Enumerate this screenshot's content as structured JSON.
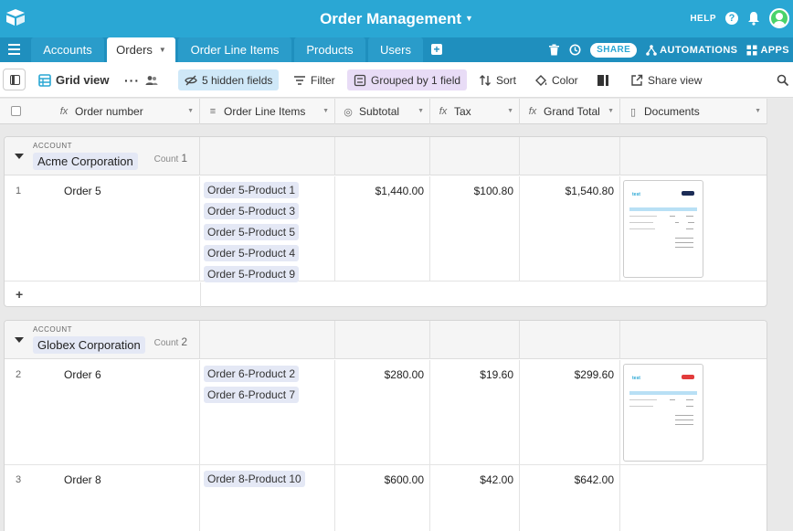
{
  "app": {
    "title": "Order Management",
    "help_label": "HELP",
    "brand_color": "#2aa7d4",
    "icons": [
      "base-logo-icon",
      "caret-down-icon",
      "help-icon",
      "bell-icon",
      "avatar"
    ]
  },
  "tabs": [
    {
      "label": "Accounts",
      "active": false
    },
    {
      "label": "Orders",
      "active": true
    },
    {
      "label": "Order Line Items",
      "active": false
    },
    {
      "label": "Products",
      "active": false
    },
    {
      "label": "Users",
      "active": false
    }
  ],
  "tabbar_actions": {
    "share": "SHARE",
    "automations": "AUTOMATIONS",
    "apps": "APPS"
  },
  "toolbar": {
    "view_name": "Grid view",
    "hidden_fields": "5 hidden fields",
    "filter": "Filter",
    "grouped": "Grouped by 1 field",
    "sort": "Sort",
    "color": "Color",
    "share_view": "Share view"
  },
  "columns": [
    {
      "name": "Order number",
      "icon": "formula-icon",
      "glyph": "fx"
    },
    {
      "name": "Order Line Items",
      "icon": "linked-records-icon",
      "glyph": "≡"
    },
    {
      "name": "Subtotal",
      "icon": "rollup-icon",
      "glyph": "◎"
    },
    {
      "name": "Tax",
      "icon": "formula-icon",
      "glyph": "fx"
    },
    {
      "name": "Grand Total",
      "icon": "formula-icon",
      "glyph": "fx"
    },
    {
      "name": "Documents",
      "icon": "attachment-icon",
      "glyph": "▯"
    }
  ],
  "groups": [
    {
      "field": "ACCOUNT",
      "name": "Acme Corporation",
      "count_label": "Count",
      "count": "1"
    },
    {
      "field": "ACCOUNT",
      "name": "Globex Corporation",
      "count_label": "Count",
      "count": "2"
    }
  ],
  "rows": [
    {
      "num": "1",
      "order": "Order 5",
      "items": [
        "Order 5-Product 1",
        "Order 5-Product 3",
        "Order 5-Product 5",
        "Order 5-Product 4",
        "Order 5-Product 9"
      ],
      "subtotal": "$1,440.00",
      "tax": "$100.80",
      "grand_total": "$1,540.80",
      "has_document": true
    },
    {
      "num": "2",
      "order": "Order 6",
      "items": [
        "Order 6-Product 2",
        "Order 6-Product 7"
      ],
      "subtotal": "$280.00",
      "tax": "$19.60",
      "grand_total": "$299.60",
      "has_document": true
    },
    {
      "num": "3",
      "order": "Order 8",
      "items": [
        "Order 8-Product 10"
      ],
      "subtotal": "$600.00",
      "tax": "$42.00",
      "grand_total": "$642.00",
      "has_document": false
    }
  ],
  "add_row": "+",
  "doc_logo": "test"
}
